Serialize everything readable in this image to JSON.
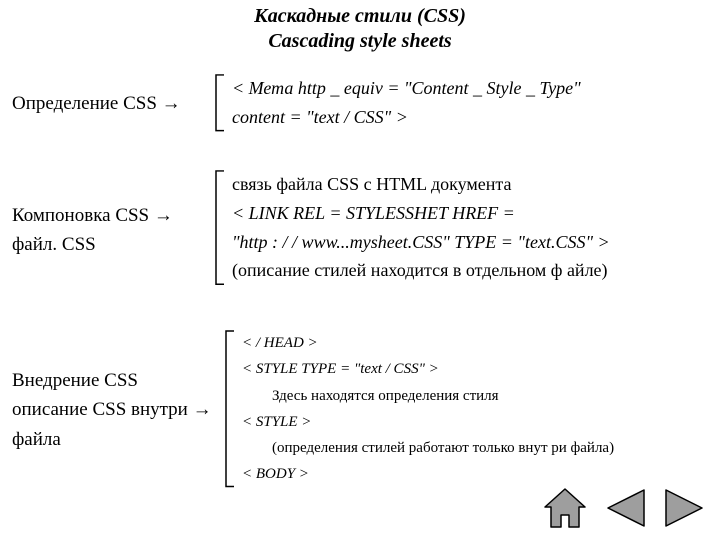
{
  "title": {
    "ru": "Каскадные стили (CSS)",
    "en": "Cascading style sheets"
  },
  "sections": [
    {
      "label_lines": [
        "Определение CSS →"
      ],
      "rhs": [
        "< Мета http _ equiv = \"Content _ Style _ Type\"",
        "   content = \"text / CSS\" >"
      ],
      "upright_rhs": [
        false,
        false
      ]
    },
    {
      "label_lines": [
        "Компоновка CSS →",
        "файл. CSS"
      ],
      "rhs": [
        "связь файла CSS с HTML документа",
        "< LINK  REL = STYLESSHET   HREF =",
        "\"http : / / www...mysheet.CSS\" TYPE = \"text.CSS\" >",
        "(описание стилей находится в отдельном ф айле)"
      ],
      "upright_rhs": [
        true,
        false,
        false,
        true
      ]
    },
    {
      "label_lines": [
        "Внедрение CSS",
        "описание CSS внутри   →",
        "файла"
      ],
      "rhs": [
        "< / HEAD >",
        "< STYLE  TYPE = \"text / CSS\" >",
        "Здесь находятся определения стиля",
        "< STYLE >",
        "(определения стилей работают только внут ри файла)",
        "< BODY >"
      ],
      "upright_rhs": [
        false,
        false,
        true,
        false,
        true,
        false
      ],
      "indent_rhs": [
        false,
        false,
        true,
        false,
        true,
        false
      ]
    }
  ],
  "nav": {
    "home": "home-icon",
    "prev": "prev-icon",
    "next": "next-icon"
  }
}
